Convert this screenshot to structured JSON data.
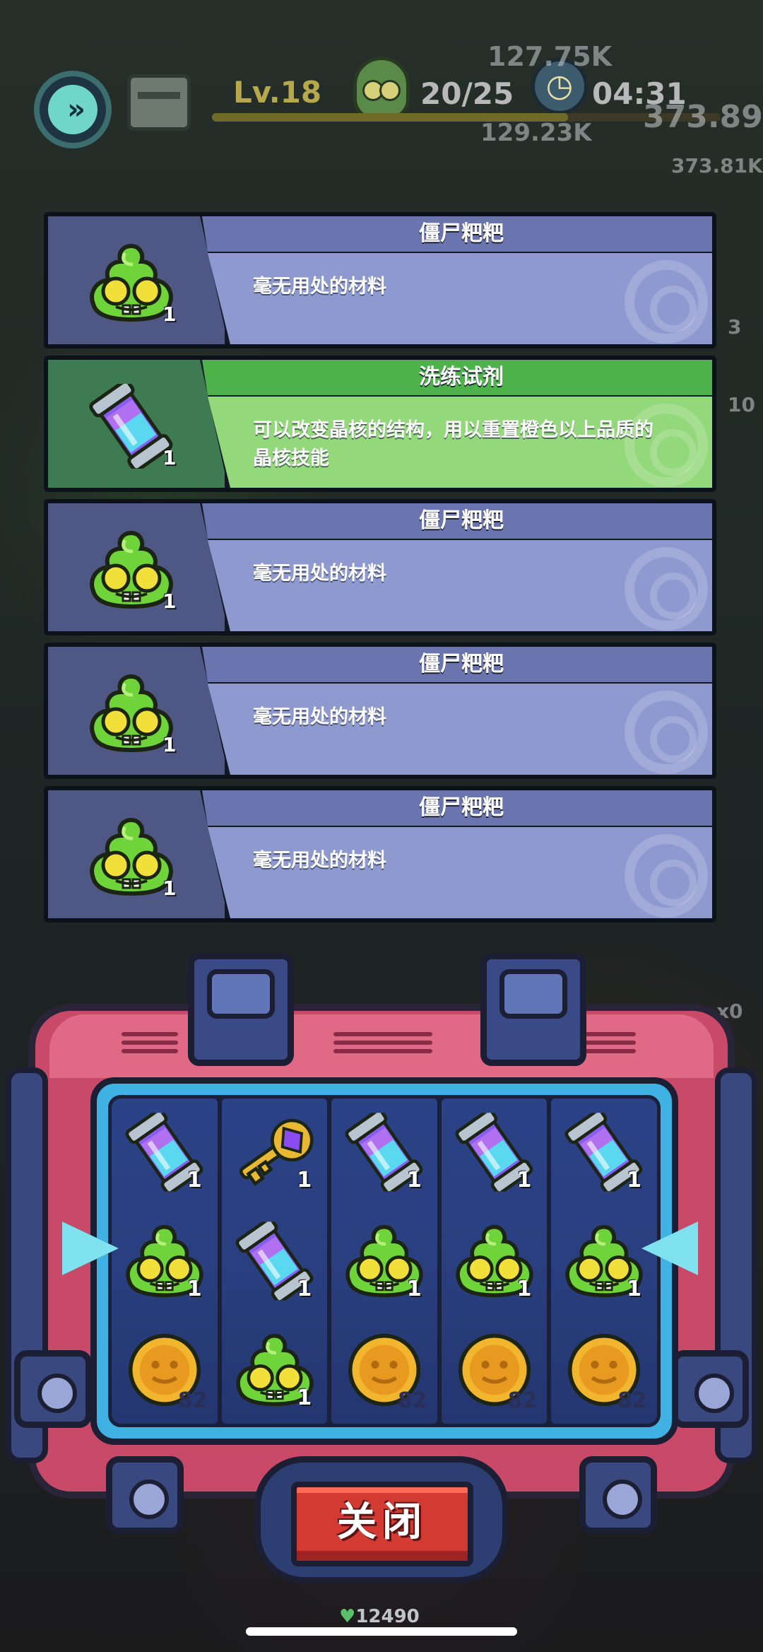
{
  "hud": {
    "level": "Lv.18",
    "wave": "20/25",
    "timer": "04:31",
    "bg_numbers": [
      "127.75K",
      "129.23K",
      "373.89",
      "373.81K",
      "3",
      "10",
      "x0",
      "12490"
    ]
  },
  "items": [
    {
      "name": "僵尸粑粑",
      "desc": "毫无用处的材料",
      "count": "1",
      "icon": "zombie-poop",
      "theme": "blue"
    },
    {
      "name": "洗练试剂",
      "desc": "可以改变晶核的结构，用以重置橙色以上品质的晶核技能",
      "count": "1",
      "icon": "reagent-vial",
      "theme": "green"
    },
    {
      "name": "僵尸粑粑",
      "desc": "毫无用处的材料",
      "count": "1",
      "icon": "zombie-poop",
      "theme": "blue"
    },
    {
      "name": "僵尸粑粑",
      "desc": "毫无用处的材料",
      "count": "1",
      "icon": "zombie-poop",
      "theme": "blue"
    },
    {
      "name": "僵尸粑粑",
      "desc": "毫无用处的材料",
      "count": "1",
      "icon": "zombie-poop",
      "theme": "blue"
    }
  ],
  "reels": [
    [
      {
        "icon": "reagent-vial",
        "count": "1"
      },
      {
        "icon": "zombie-poop",
        "count": "1"
      },
      {
        "icon": "gold-coin",
        "count": "82"
      }
    ],
    [
      {
        "icon": "purple-key",
        "count": "1"
      },
      {
        "icon": "reagent-vial",
        "count": "1"
      },
      {
        "icon": "zombie-poop",
        "count": "1"
      }
    ],
    [
      {
        "icon": "reagent-vial",
        "count": "1"
      },
      {
        "icon": "zombie-poop",
        "count": "1"
      },
      {
        "icon": "gold-coin",
        "count": "82"
      }
    ],
    [
      {
        "icon": "reagent-vial",
        "count": "1"
      },
      {
        "icon": "zombie-poop",
        "count": "1"
      },
      {
        "icon": "gold-coin",
        "count": "82"
      }
    ],
    [
      {
        "icon": "reagent-vial",
        "count": "1"
      },
      {
        "icon": "zombie-poop",
        "count": "1"
      },
      {
        "icon": "gold-coin",
        "count": "82"
      }
    ]
  ],
  "close_label": "关闭",
  "hearts_count": "12490",
  "colors": {
    "card_blue": "#6a75b0",
    "card_green": "#4db24a",
    "box_pink": "#c94a68",
    "screen_cyan": "#3fb1e2",
    "close_red": "#d23a32"
  }
}
